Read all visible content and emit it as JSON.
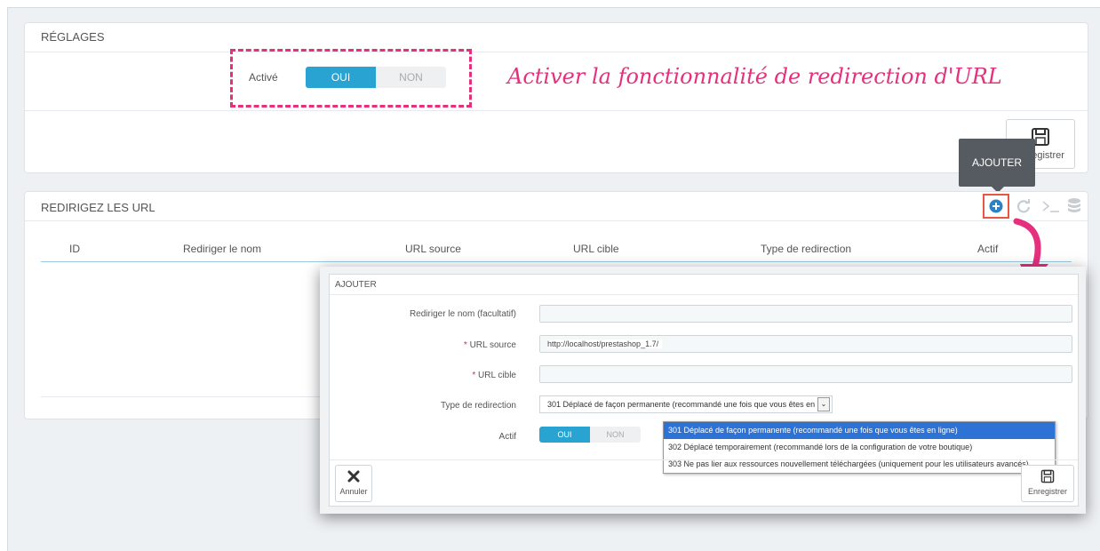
{
  "settings": {
    "title": "RÉGLAGES",
    "active_label": "Activé",
    "toggle_on": "OUI",
    "toggle_off": "NON",
    "save_label": "Enregistrer"
  },
  "annotation": "Activer la fonctionnalité de redirection d'URL",
  "tooltip": "AJOUTER",
  "redirects": {
    "title": "REDIRIGEZ LES URL",
    "columns": [
      "ID",
      "Rediriger le nom",
      "URL source",
      "URL cible",
      "Type de redirection",
      "Actif"
    ]
  },
  "modal": {
    "title": "AJOUTER",
    "name_label": "Rediriger le nom (facultatif)",
    "source_label": "URL source",
    "source_value": "http://localhost/prestashop_1.7/",
    "target_label": "URL cible",
    "type_label": "Type de redirection",
    "type_value": "301 Déplacé de façon permanente (recommandé une fois que vous êtes en",
    "active_label": "Actif",
    "toggle_on": "OUI",
    "toggle_off": "NON",
    "options": [
      "301 Déplacé de façon permanente (recommandé une fois que vous êtes en ligne)",
      "302 Déplacé temporairement (recommandé lors de la configuration de votre boutique)",
      "303 Ne pas lier aux ressources nouvellement téléchargées (uniquement pour les utilisateurs avancés)"
    ],
    "cancel_label": "Annuler",
    "save_label": "Enregistrer"
  },
  "colors": {
    "accent": "#29a3d2",
    "annotation": "#e5307d",
    "highlight": "#e8573f",
    "dropdown_selected": "#2d73d6"
  },
  "icons": [
    "save-icon",
    "add-icon",
    "refresh-icon",
    "terminal-icon",
    "database-icon",
    "close-icon",
    "arrow-icon"
  ]
}
